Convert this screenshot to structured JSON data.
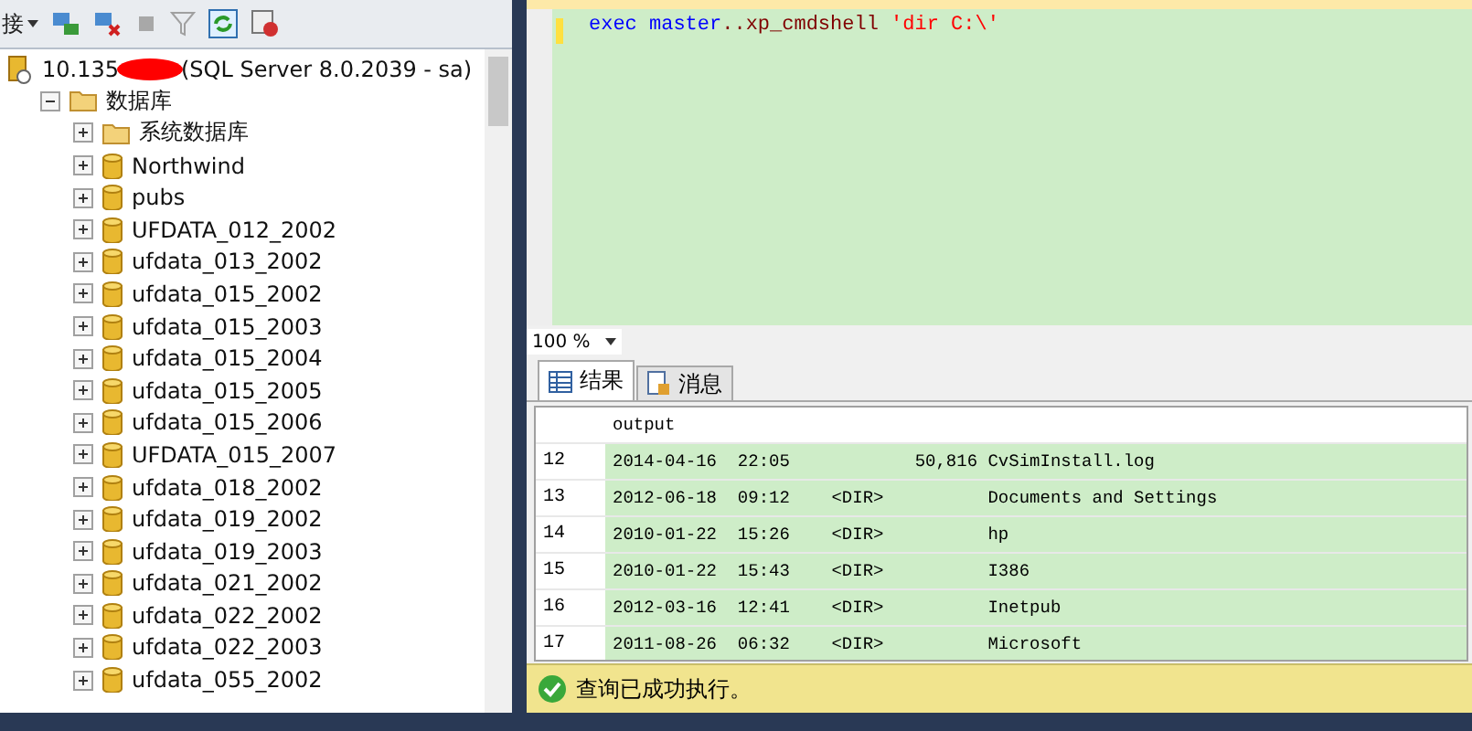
{
  "toolbar": {
    "connect_label": "接"
  },
  "tree": [
    {
      "kind": "server",
      "label": "10.135",
      "suffix": "(SQL Server 8.0.2039 - sa)",
      "children": [
        {
          "kind": "folder",
          "label": "数据库",
          "expanded": true,
          "children": [
            {
              "kind": "folder",
              "label": "系统数据库",
              "expanded": false
            },
            {
              "kind": "database",
              "label": "Northwind",
              "expanded": false
            },
            {
              "kind": "database",
              "label": "pubs",
              "expanded": false
            },
            {
              "kind": "database",
              "label": "UFDATA_012_2002",
              "expanded": false
            },
            {
              "kind": "database",
              "label": "ufdata_013_2002",
              "expanded": false
            },
            {
              "kind": "database",
              "label": "ufdata_015_2002",
              "expanded": false
            },
            {
              "kind": "database",
              "label": "ufdata_015_2003",
              "expanded": false
            },
            {
              "kind": "database",
              "label": "ufdata_015_2004",
              "expanded": false
            },
            {
              "kind": "database",
              "label": "ufdata_015_2005",
              "expanded": false
            },
            {
              "kind": "database",
              "label": "ufdata_015_2006",
              "expanded": false
            },
            {
              "kind": "database",
              "label": "UFDATA_015_2007",
              "expanded": false
            },
            {
              "kind": "database",
              "label": "ufdata_018_2002",
              "expanded": false
            },
            {
              "kind": "database",
              "label": "ufdata_019_2002",
              "expanded": false
            },
            {
              "kind": "database",
              "label": "ufdata_019_2003",
              "expanded": false
            },
            {
              "kind": "database",
              "label": "ufdata_021_2002",
              "expanded": false
            },
            {
              "kind": "database",
              "label": "ufdata_022_2002",
              "expanded": false
            },
            {
              "kind": "database",
              "label": "ufdata_022_2003",
              "expanded": false
            },
            {
              "kind": "database",
              "label": "ufdata_055_2002",
              "expanded": false
            }
          ]
        }
      ]
    }
  ],
  "editor": {
    "tokens": [
      {
        "kind": "keyword",
        "text": "exec master"
      },
      {
        "kind": "identifier",
        "text": "..xp_cmdshell"
      },
      {
        "kind": "string",
        "text": " 'dir C:\\'"
      }
    ]
  },
  "zoom": "100 %",
  "tabs": [
    {
      "label": "结果",
      "selected": true,
      "kind": "grid"
    },
    {
      "label": "消息",
      "selected": false,
      "kind": "messages"
    }
  ],
  "grid": {
    "columns": [
      "output"
    ],
    "rows": [
      {
        "number": "12",
        "output": "2014-04-16  22:05            50,816 CvSimInstall.log"
      },
      {
        "number": "13",
        "output": "2012-06-18  09:12    <DIR>          Documents and Settings"
      },
      {
        "number": "14",
        "output": "2010-01-22  15:26    <DIR>          hp"
      },
      {
        "number": "15",
        "output": "2010-01-22  15:43    <DIR>          I386"
      },
      {
        "number": "16",
        "output": "2012-03-16  12:41    <DIR>          Inetpub"
      },
      {
        "number": "17",
        "output": "2011-08-26  06:32    <DIR>          Microsoft"
      }
    ]
  },
  "status_bar": {
    "message": "查询已成功执行。"
  }
}
